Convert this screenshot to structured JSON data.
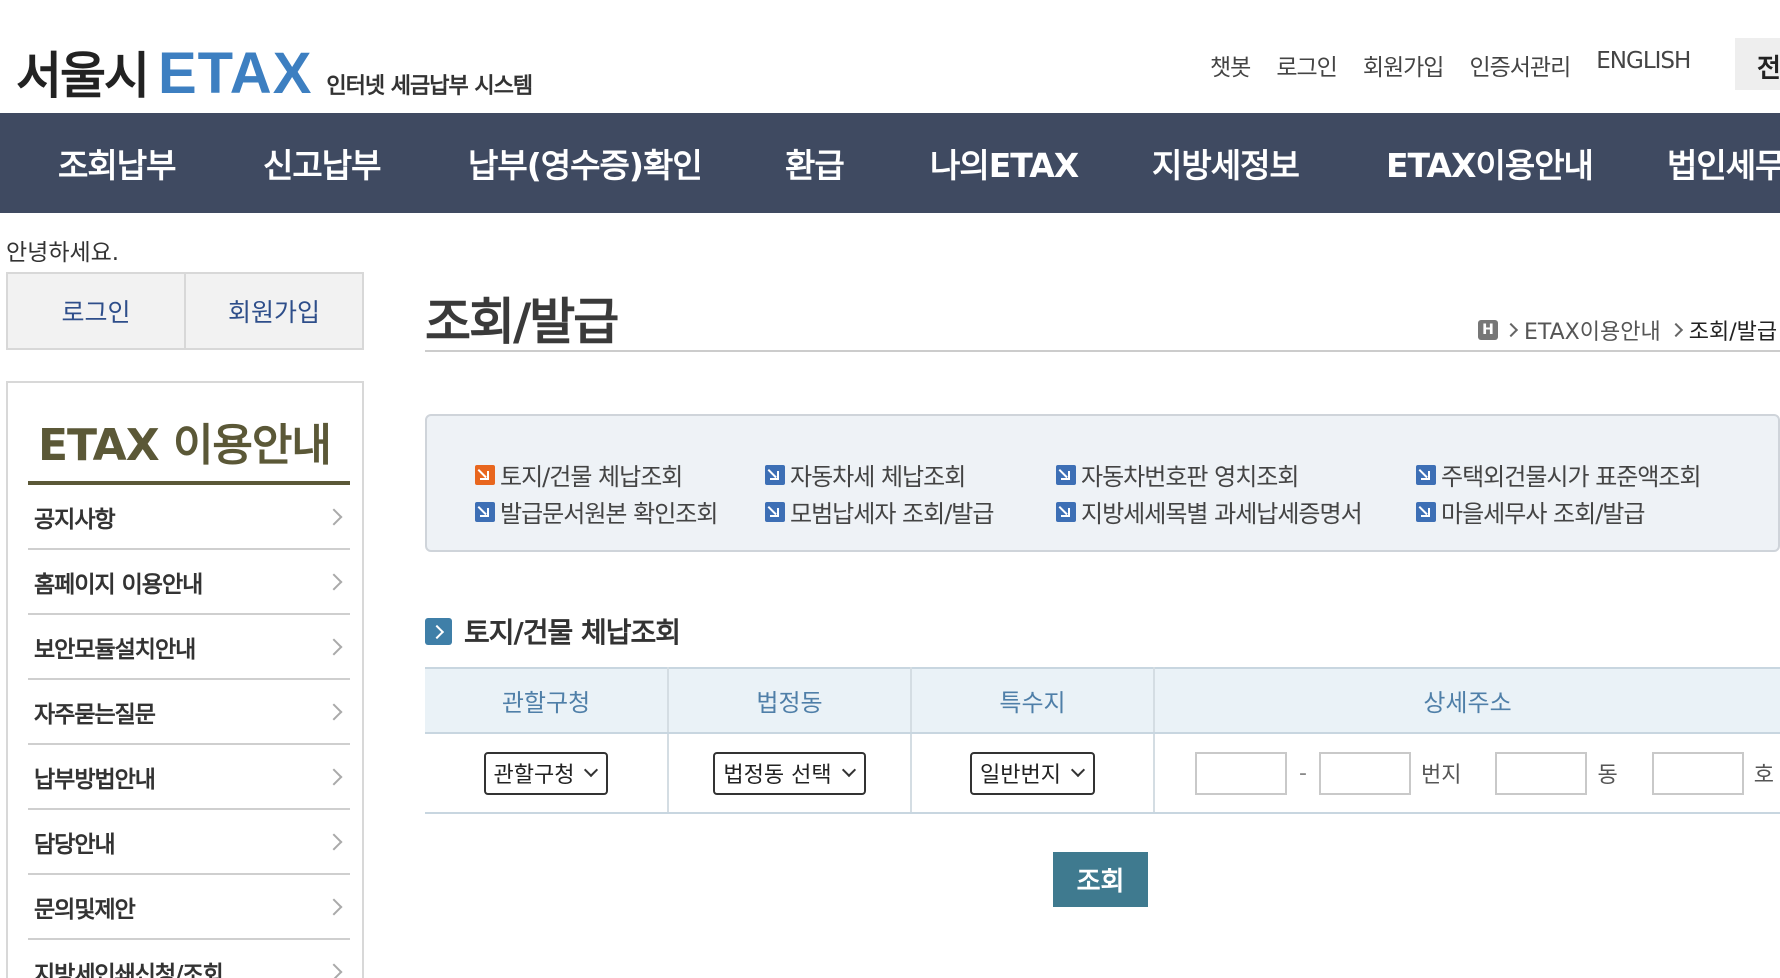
{
  "header": {
    "logo_seoul": "서울시",
    "logo_etax": "ETAX",
    "logo_sub": "인터넷 세금납부 시스템",
    "util_links": [
      "챗봇",
      "로그인",
      "회원가입",
      "인증서관리",
      "ENGLISH"
    ],
    "util_box": "전"
  },
  "gnb": {
    "items": [
      "조회납부",
      "신고납부",
      "납부(영수증)확인",
      "환급",
      "나의ETAX",
      "지방세정보",
      "ETAX이용안내",
      "법인세무"
    ]
  },
  "sidebar": {
    "greeting": "안녕하세요.",
    "login": "로그인",
    "join": "회원가입",
    "title": "ETAX 이용안내",
    "items": [
      "공지사항",
      "홈페이지 이용안내",
      "보안모듈설치안내",
      "자주묻는질문",
      "납부방법안내",
      "담당안내",
      "문의및제안",
      "지방세인쇄신청/조회"
    ]
  },
  "main": {
    "title": "조회/발급",
    "breadcrumb": {
      "home": "H",
      "level1": "ETAX이용안내",
      "level2": "조회/발급"
    },
    "quick_links": [
      "토지/건물 체납조회",
      "자동차세 체납조회",
      "자동차번호판 영치조회",
      "주택외건물시가 표준액조회",
      "발급문서원본 확인조회",
      "모범납세자 조회/발급",
      "지방세세목별 과세납세증명서",
      "마을세무사 조회/발급"
    ],
    "section_title": "토지/건물 체납조회",
    "table": {
      "headers": [
        "관할구청",
        "법정동",
        "특수지",
        "상세주소"
      ],
      "select_district": "관할구청",
      "select_dong": "법정동 선택",
      "select_special": "일반번지",
      "dash": "-",
      "unit_bunji": "번지",
      "unit_dong": "동",
      "unit_ho": "호"
    },
    "search_button": "조회"
  }
}
